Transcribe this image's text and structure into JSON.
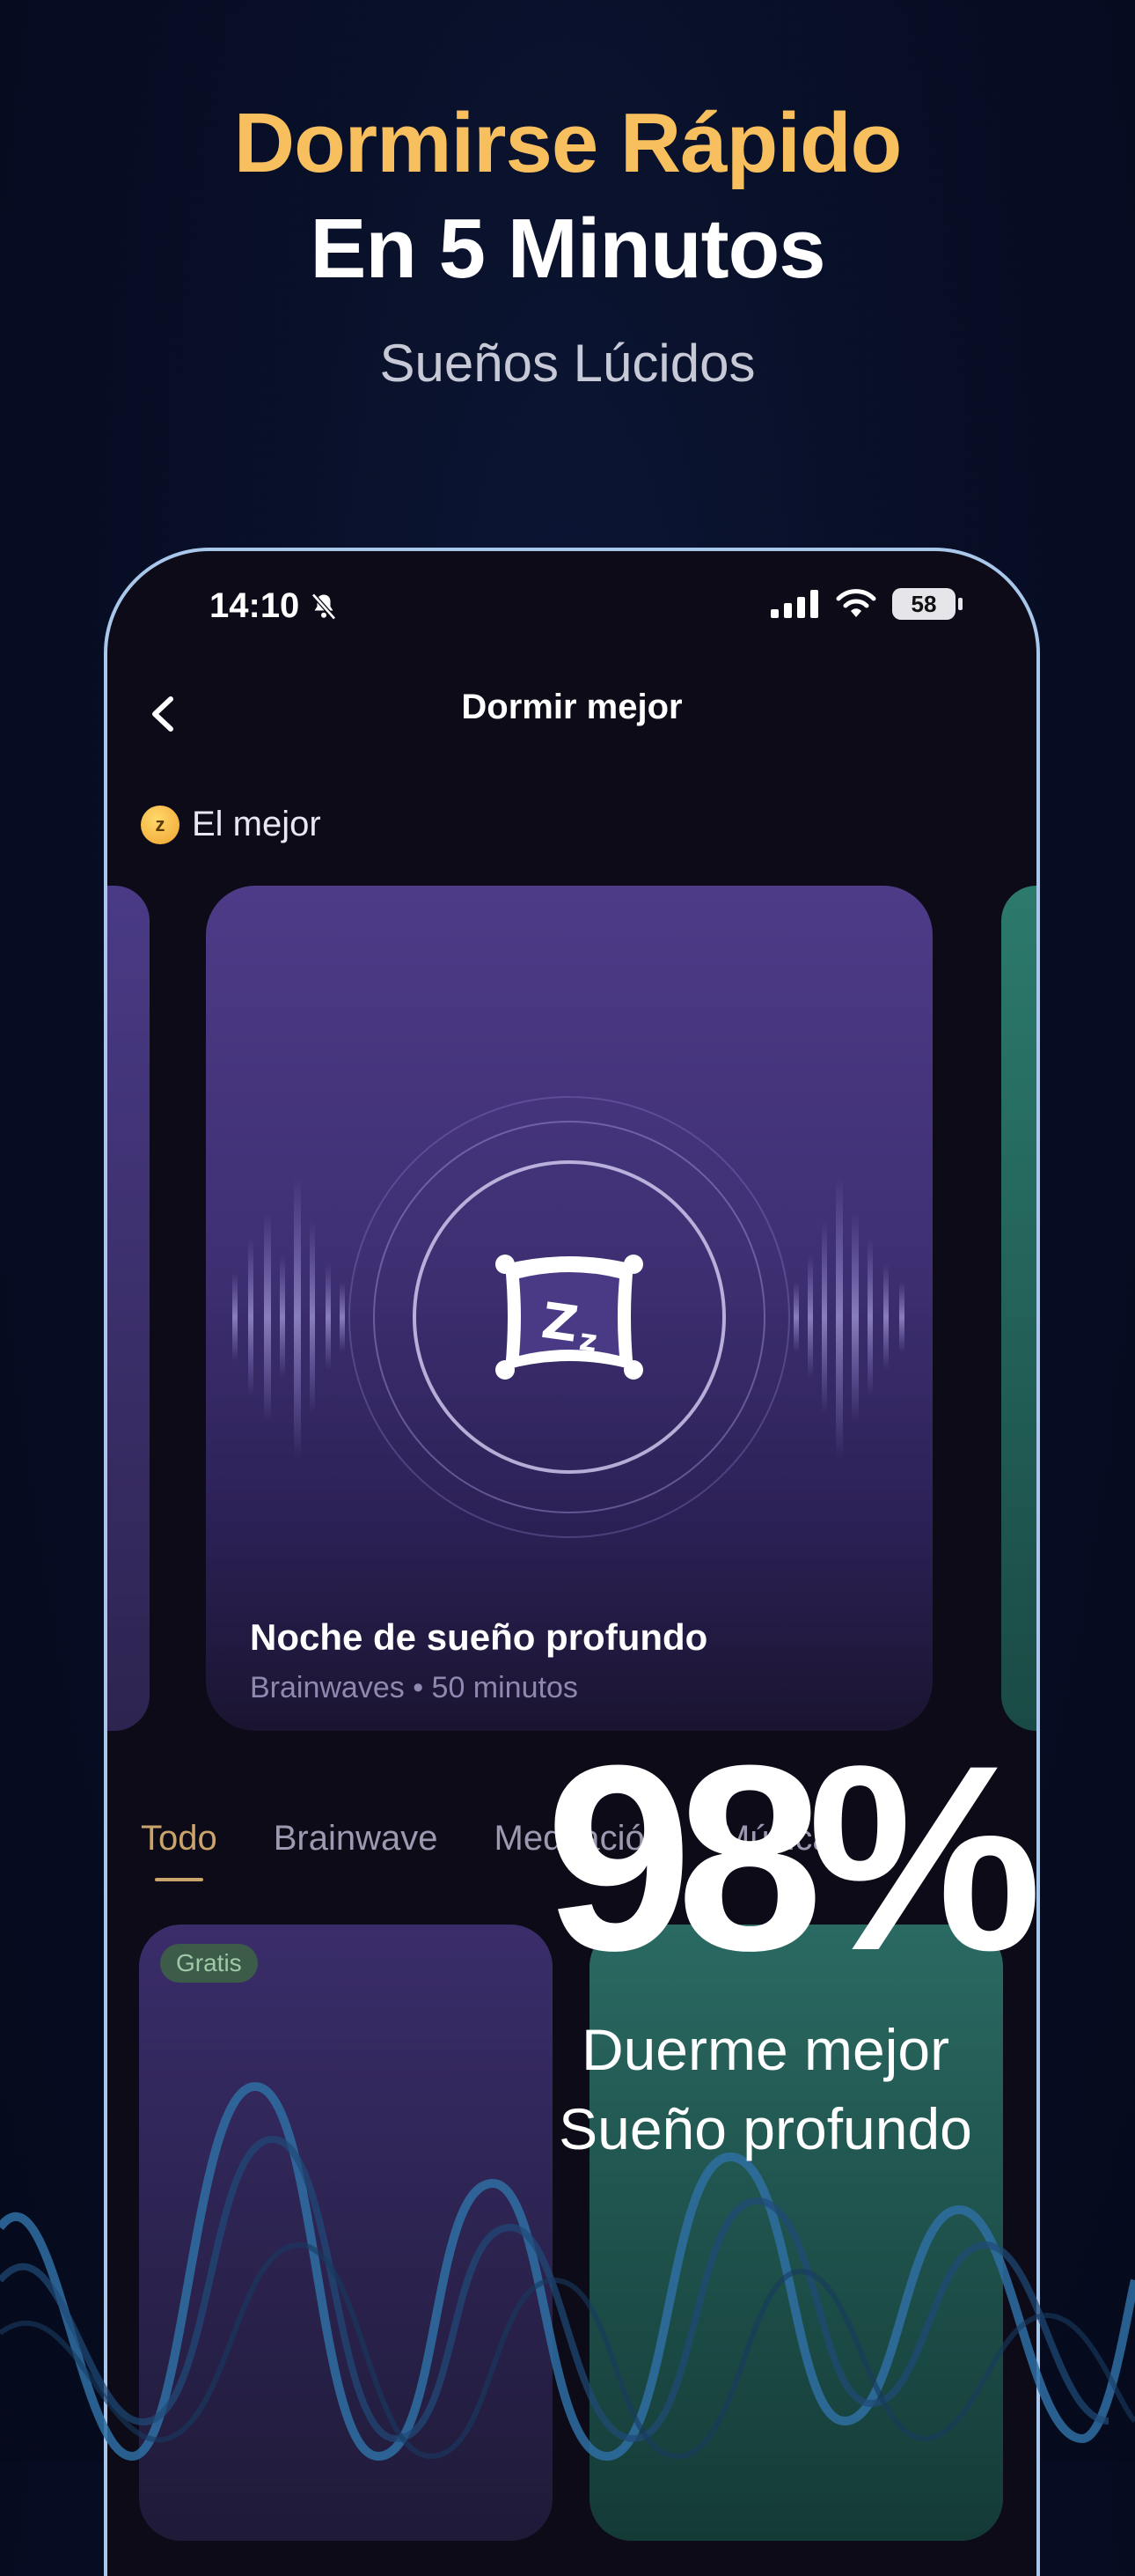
{
  "headline": {
    "line1": "Dormirse Rápido",
    "line2": "En 5 Minutos",
    "subtitle": "Sueños Lúcidos"
  },
  "status_bar": {
    "time": "14:10",
    "battery": "58"
  },
  "nav": {
    "title": "Dormir mejor"
  },
  "section": {
    "label": "El mejor"
  },
  "featured_card": {
    "title": "Noche de sueño profundo",
    "subtitle": "Brainwaves • 50 minutos"
  },
  "tabs": [
    {
      "label": "Todo",
      "active": true
    },
    {
      "label": "Brainwave",
      "active": false
    },
    {
      "label": "Meditación",
      "active": false
    },
    {
      "label": "Música",
      "active": false
    }
  ],
  "grid": {
    "badge": "Gratis"
  },
  "promo": {
    "stat": "98%",
    "caption_line1": "Duerme mejor",
    "caption_line2": "Sueño profundo"
  },
  "colors": {
    "headline_accent": "#f7bf5e",
    "tab_active": "#caa46a",
    "phone_frame": "#a9c7ea"
  }
}
